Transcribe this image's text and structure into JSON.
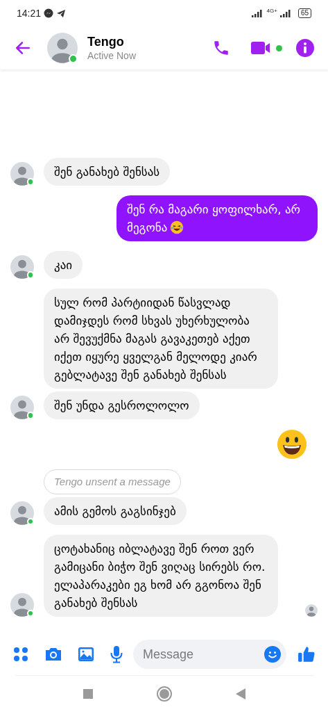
{
  "status_bar": {
    "time": "14:21",
    "network": "4G+",
    "battery": "65"
  },
  "header": {
    "name": "Tengo",
    "status": "Active Now",
    "online": true
  },
  "messages": [
    {
      "kind": "text",
      "outgoing": false,
      "avatar": true,
      "text": "შენ განახებ შენსას"
    },
    {
      "kind": "text_emoji",
      "outgoing": true,
      "text": "შენ რა მაგარი ყოფილხარ, არ მეგონა"
    },
    {
      "kind": "text",
      "outgoing": false,
      "avatar": true,
      "text": "კაი"
    },
    {
      "kind": "text",
      "outgoing": false,
      "avatar": false,
      "text": "სულ რომ პარტიიდან წასვლად დამიჯდეს რომ სხვას უხერხულობა არ შევუქმნა მაგას გავაკეთებ აქეთ იქეთ იყურე ყველგან მელოდე კიარ გებლატავე შენ განახებ შენსას"
    },
    {
      "kind": "text",
      "outgoing": false,
      "avatar": true,
      "text": "შენ უნდა გესროლოლო"
    },
    {
      "kind": "emoji",
      "outgoing": true
    },
    {
      "kind": "unsent",
      "outgoing": false,
      "avatar": false,
      "text": "Tengo unsent a message"
    },
    {
      "kind": "text",
      "outgoing": false,
      "avatar": true,
      "text": "ამის გემოს გაგსინჯებ"
    },
    {
      "kind": "text",
      "outgoing": false,
      "avatar": true,
      "seen": true,
      "text": "ცოტახანიც იბლატავე შენ როთ ვერ გამიცანი ბიჭო შენ ვიღაც სირებს რო. ელაპარაკები ეგ ხომ არ გგონოა შენ განახებ შენსას"
    }
  ],
  "composer": {
    "placeholder": "Message"
  }
}
